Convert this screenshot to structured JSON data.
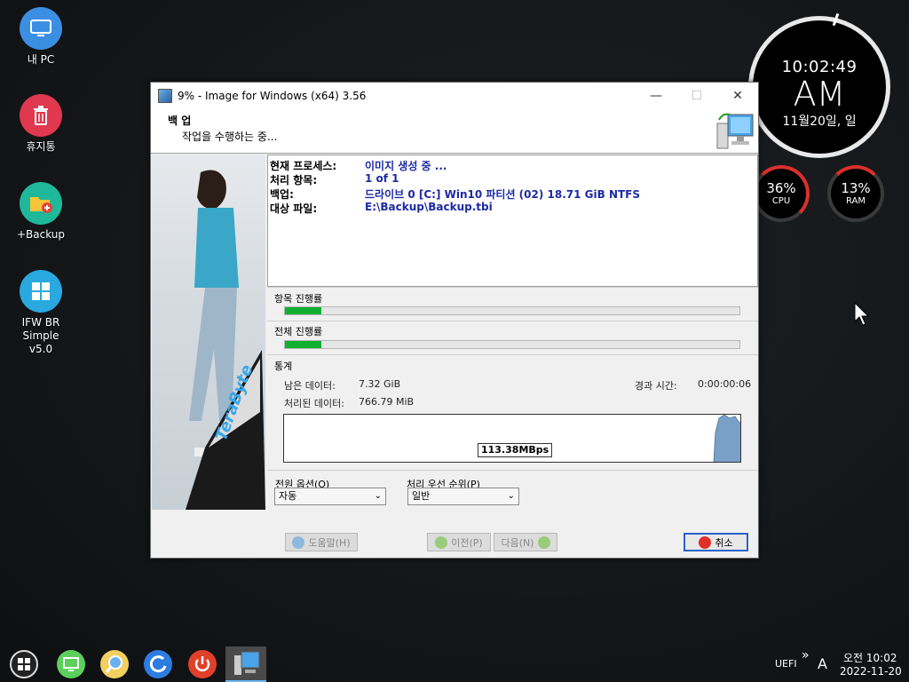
{
  "desktop": {
    "icons": [
      {
        "label": "내 PC",
        "icon": "monitor-icon"
      },
      {
        "label": "휴지통",
        "icon": "trash-icon"
      },
      {
        "label": "+Backup",
        "icon": "folder-plus-icon"
      },
      {
        "label": "IFW BR Simple",
        "label2": "v5.0",
        "icon": "windows-logo-icon"
      }
    ]
  },
  "clock": {
    "time": "10:02:49",
    "ampm": "AM",
    "date": "11월20일, 일"
  },
  "gauges": [
    {
      "value": "36%",
      "label": "CPU",
      "level": 0.36,
      "color": "#d9302c"
    },
    {
      "value": "13%",
      "label": "RAM",
      "level": 0.13,
      "color": "#d9302c"
    }
  ],
  "window": {
    "title": "9% - Image for Windows (x64) 3.56",
    "header_title": "백 업",
    "header_sub": "작업을 수행하는 중...",
    "info": [
      {
        "key": "현재 프로세스:",
        "value": "이미지 생성 중 ..."
      },
      {
        "key": "처리 항목:",
        "value": "1 of 1"
      },
      {
        "key": "백업:",
        "value": "드라이브 0 [C:] Win10 파티션 (02) 18.71 GiB NTFS"
      },
      {
        "key": "대상 파일:",
        "value": "E:\\Backup\\Backup.tbi"
      }
    ],
    "item_progress_label": "항목 진행률",
    "item_progress": 0.08,
    "total_progress_label": "전체 진행률",
    "total_progress": 0.08,
    "stats_label": "통계",
    "remaining_label": "남은 데이터:",
    "remaining_value": "7.32 GiB",
    "processed_label": "처리된 데이터:",
    "processed_value": "766.79 MiB",
    "elapsed_label": "경과 시간:",
    "elapsed_value": "0:00:00:06",
    "speed": "113.38MBps",
    "power_label": "전원 옵션(O)",
    "power_value": "자동",
    "priority_label": "처리 우선 순위(P)",
    "priority_value": "일반",
    "help_label": "도움말(H)",
    "prev_label": "이전(P)",
    "next_label": "다음(N)",
    "cancel_label": "취소",
    "brand": "TeraByte"
  },
  "taskbar": {
    "tray_uefi": "UEFI",
    "tray_chevron": "»",
    "tray_ime": "A",
    "tray_time": "오전 10:02",
    "tray_date": "2022-11-20"
  }
}
